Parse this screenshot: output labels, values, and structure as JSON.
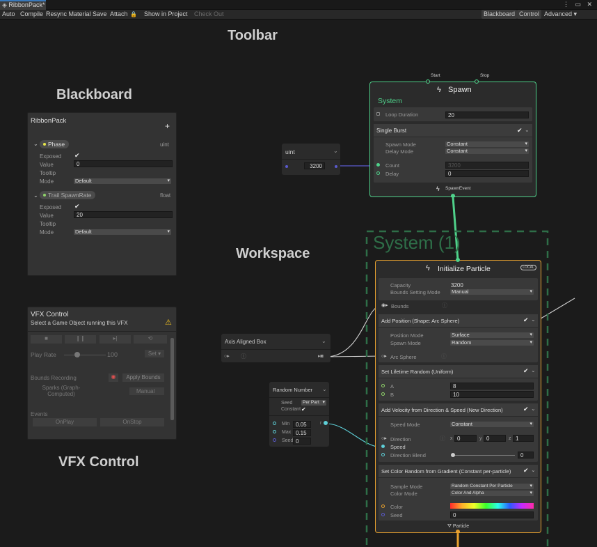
{
  "window": {
    "tab_title": "RibbonPack*",
    "controls": "⋮ ▭ ✕"
  },
  "toolbar": {
    "auto": "Auto",
    "compile": "Compile",
    "resync": "Resync Material",
    "save": "Save",
    "attach": "Attach",
    "lock_icon": "🔒",
    "show_in_project": "Show in Project",
    "check_out": "Check Out",
    "blackboard": "Blackboard",
    "control": "Control",
    "advanced": "Advanced ▾"
  },
  "captions": {
    "toolbar": "Toolbar",
    "blackboard": "Blackboard",
    "workspace": "Workspace",
    "vfx_control": "VFX Control"
  },
  "blackboard": {
    "title": "RibbonPack",
    "add": "+",
    "props": [
      {
        "name": "Phase",
        "type": "uint",
        "exposed_label": "Exposed",
        "value_label": "Value",
        "value": "0",
        "tooltip_label": "Tooltip",
        "mode_label": "Mode",
        "mode": "Default"
      },
      {
        "name": "Trail SpawnRate",
        "type": "float",
        "exposed_label": "Exposed",
        "value_label": "Value",
        "value": "20",
        "tooltip_label": "Tooltip",
        "mode_label": "Mode",
        "mode": "Default"
      }
    ]
  },
  "vfx_control": {
    "title": "VFX Control",
    "subtitle": "Select a Game Object running this VFX",
    "warn": "⚠",
    "play_rate_label": "Play Rate",
    "play_rate": "100",
    "set": "Set",
    "bounds_label": "Bounds Recording",
    "apply_bounds": "Apply Bounds",
    "sparks_label": "Sparks (Graph-Computed)",
    "manual": "Manual",
    "events_label": "Events",
    "on_play": "OnPlay",
    "on_stop": "OnStop"
  },
  "uint_node": {
    "title": "uint",
    "value": "3200"
  },
  "spawn": {
    "start": "Start",
    "stop": "Stop",
    "title": "Spawn",
    "system": "System",
    "loop_duration_label": "Loop Duration",
    "loop_duration": "20",
    "single_burst": "Single Burst",
    "spawn_mode_label": "Spawn Mode",
    "spawn_mode": "Constant",
    "delay_mode_label": "Delay Mode",
    "delay_mode": "Constant",
    "count_label": "Count",
    "count": "3200",
    "delay_label": "Delay",
    "delay": "0",
    "footer": "SpawnEvent"
  },
  "system_label": "System (1)",
  "aab_node": {
    "title": "Axis Aligned Box"
  },
  "random_node": {
    "title": "Random Number",
    "seed_label": "Seed",
    "seed_mode": "Per Part",
    "constant_label": "Constant",
    "min_label": "Min",
    "min": "0.05",
    "max_label": "Max",
    "max": "0.15",
    "seed2_label": "Seed",
    "seed2": "0",
    "r": "r"
  },
  "init": {
    "title": "Initialize Particle",
    "local": "LOCAL",
    "capacity_label": "Capacity",
    "capacity": "3200",
    "bounds_mode_label": "Bounds Setting Mode",
    "bounds_mode": "Manual",
    "bounds_label": "Bounds",
    "blocks": {
      "pos_title": "Add Position (Shape: Arc Sphere)",
      "pos_mode_label": "Position Mode",
      "pos_mode": "Surface",
      "spawn_mode_label": "Spawn Mode",
      "spawn_mode": "Random",
      "arc_sphere_label": "Arc Sphere",
      "life_title": "Set Lifetime Random (Uniform)",
      "a_label": "A",
      "a": "8",
      "b_label": "B",
      "b": "10",
      "vel_title": "Add Velocity from Direction & Speed (New Direction)",
      "speed_mode_label": "Speed Mode",
      "speed_mode": "Constant",
      "direction_label": "Direction",
      "dx_label": "x",
      "dx": "0",
      "dy_label": "y",
      "dy": "0",
      "dz_label": "z",
      "dz": "1",
      "speed_label": "Speed",
      "dir_blend_label": "Direction Blend",
      "dir_blend": "0",
      "color_title": "Set Color Random from Gradient (Constant per-particle)",
      "sample_mode_label": "Sample Mode",
      "sample_mode": "Random Constant Per Particle",
      "color_mode_label": "Color Mode",
      "color_mode": "Color And Alpha",
      "color_label": "Color",
      "seed_label": "Seed",
      "seed": "0"
    },
    "footer": "Particle"
  },
  "colors": {
    "green": "#4fd18a",
    "orange": "#e7a02e",
    "accent": "#3a79bb"
  }
}
